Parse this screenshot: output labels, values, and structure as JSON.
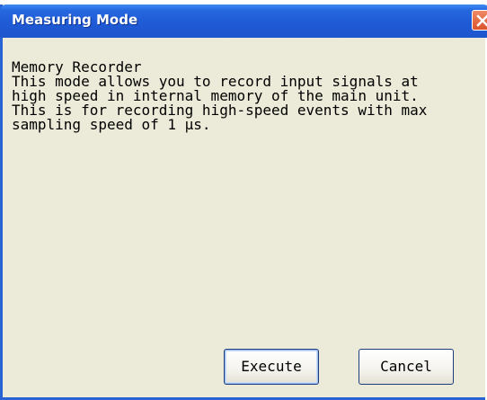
{
  "window": {
    "title": "Measuring Mode"
  },
  "content": {
    "mode_name": "Memory Recorder",
    "description_lines": [
      "This mode allows you to record input signals at",
      "high speed in internal memory of the main unit.",
      "This is for recording high-speed events with max",
      "sampling speed of 1 µs."
    ]
  },
  "buttons": {
    "execute": "Execute",
    "cancel": "Cancel"
  },
  "icons": {
    "close": "close-icon"
  },
  "colors": {
    "titlebar": "#1f5bd6",
    "close_button": "#e0623a",
    "dialog_background": "#ecead8"
  }
}
